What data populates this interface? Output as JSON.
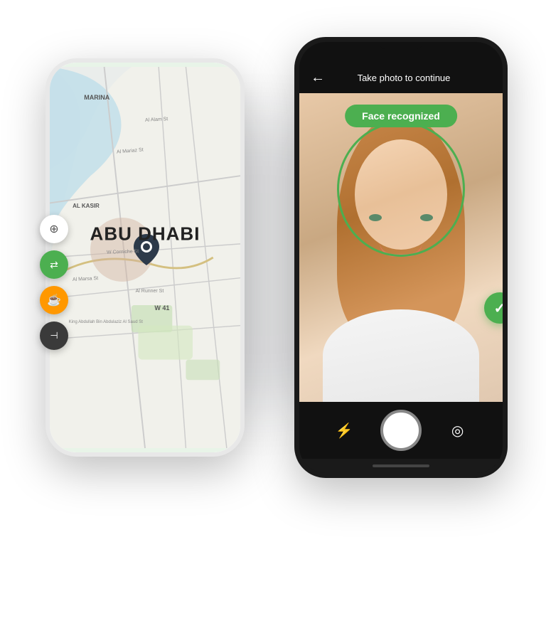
{
  "scene": {
    "background": "#ffffff"
  },
  "phone_back": {
    "map_label": "ABU DHABI",
    "marina_label": "MARINA",
    "kasir_label": "AL KASIR"
  },
  "phone_front": {
    "top_bar_title": "Take photo to continue",
    "face_recognized_label": "Face recognized",
    "back_icon": "←",
    "flash_icon": "⚡",
    "flip_icon": "◎"
  },
  "sidebar": {
    "compass_icon": "⊕",
    "swap_icon": "⇄",
    "coffee_icon": "☕",
    "back_icon": "⊣"
  }
}
